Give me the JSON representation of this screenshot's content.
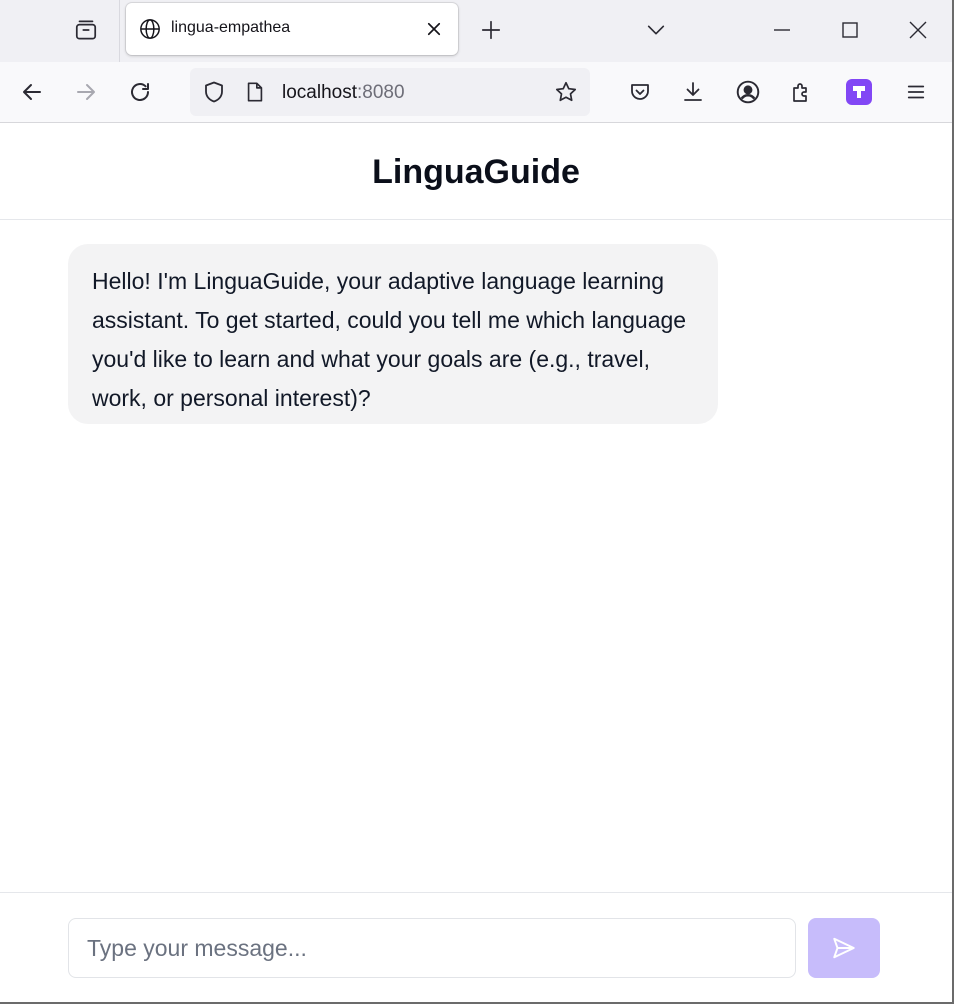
{
  "browser": {
    "tab": {
      "title": "lingua-empathea",
      "favicon": "globe-icon"
    },
    "toolbar_icons": [
      "tab-overview-icon",
      "new-tab-icon",
      "list-tabs-icon",
      "minimize-icon",
      "maximize-icon",
      "window-close-icon"
    ],
    "nav_icons": [
      "back-icon",
      "forward-icon",
      "reload-icon",
      "shield-icon",
      "page-icon",
      "bookmark-star-icon",
      "pocket-icon",
      "download-icon",
      "account-icon",
      "extensions-icon",
      "extension-badge-icon",
      "menu-icon"
    ],
    "url": {
      "host": "localhost",
      "port": ":8080"
    },
    "accent": "#8247f5"
  },
  "app": {
    "title": "LinguaGuide",
    "messages": [
      {
        "role": "assistant",
        "text": "Hello! I'm LinguaGuide, your adaptive language learning assistant. To get started, could you tell me which language you'd like to learn and what your goals are (e.g., travel, work, or personal interest)?"
      }
    ],
    "composer": {
      "placeholder": "Type your message...",
      "value": "",
      "send_icon": "send-icon",
      "send_color": "#c7bcfb"
    }
  }
}
